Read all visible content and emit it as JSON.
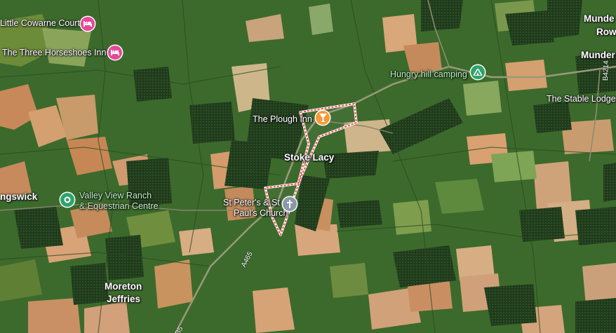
{
  "colors": {
    "lodging": "#e8489a",
    "food": "#f29a3a",
    "park": "#2fa36b",
    "church": "#8a98a8",
    "boundary": "#f04a4a"
  },
  "places": {
    "little_cowarne_court": "Little Cowarne Court",
    "three_horseshoes": "The Three Horseshoes Inn",
    "hungry_hill": "Hungry hill camping",
    "stable_lodge": "The Stable Lodge",
    "munder_row_1": "Munde",
    "munder_row_2": "Row",
    "munder_2": "Munder",
    "plough_inn": "The Plough Inn",
    "stoke_lacy": "Stoke Lacy",
    "ngswick": "ngswick",
    "valley_view_1": "Valley View Ranch",
    "valley_view_2": "& Equestrian Centre",
    "church_1": "St Peter's & St",
    "church_2": "Paul's Church",
    "moreton_1": "Moreton",
    "moreton_2": "Jeffries"
  },
  "roads": {
    "a465": "A465",
    "b4214": "B4214",
    "b5": "B5"
  },
  "icons": {
    "lodging": "hotel-bed-icon",
    "food": "cocktail-glass-icon",
    "camping": "tent-icon",
    "church": "cross-icon",
    "ranch": "map-pin-icon"
  }
}
